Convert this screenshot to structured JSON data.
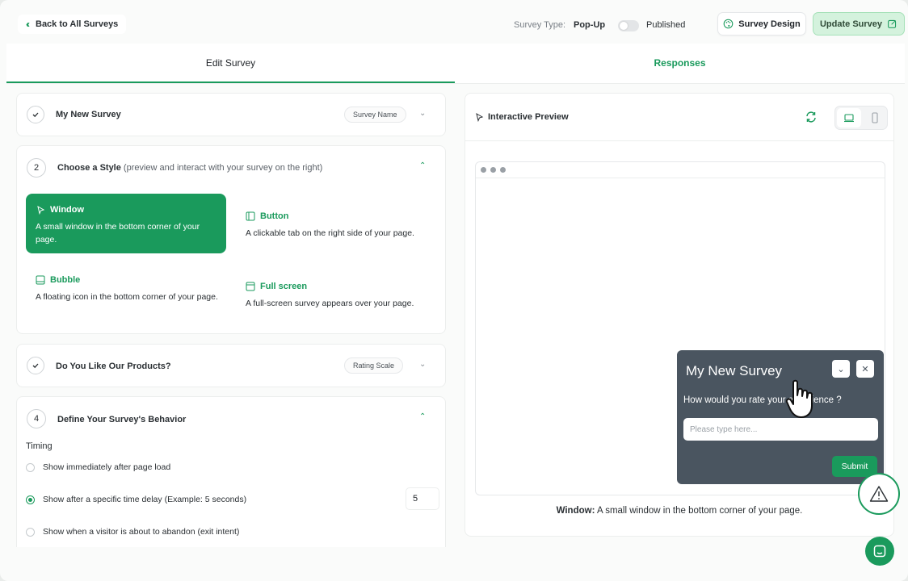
{
  "topbar": {
    "back_label": "Back to All Surveys",
    "survey_type_label": "Survey Type:",
    "survey_type_value": "Pop-Up",
    "published_label": "Published",
    "published_on": false,
    "design_label": "Survey Design",
    "update_label": "Update Survey"
  },
  "tabs": {
    "edit": "Edit Survey",
    "responses": "Responses"
  },
  "steps": {
    "name": {
      "title": "My New Survey",
      "pill": "Survey Name"
    },
    "style": {
      "number": "2",
      "title": "Choose a Style",
      "subtitle": "(preview and interact with your survey on the right)",
      "options": [
        {
          "title": "Window",
          "desc": "A small window in the bottom corner of your page.",
          "selected": true
        },
        {
          "title": "Button",
          "desc": "A clickable tab on the right side of your page.",
          "selected": false
        },
        {
          "title": "Bubble",
          "desc": "A floating icon in the bottom corner of your page.",
          "selected": false
        },
        {
          "title": "Full screen",
          "desc": "A full-screen survey appears over your page.",
          "selected": false
        }
      ]
    },
    "question": {
      "title": "Do You Like Our Products?",
      "pill": "Rating Scale"
    },
    "behavior": {
      "number": "4",
      "title": "Define Your Survey's Behavior",
      "timing_label": "Timing",
      "options": [
        "Show immediately after page load",
        "Show after a specific time delay (Example: 5 seconds)",
        "Show when a visitor is about to abandon (exit intent)"
      ],
      "selected_index": 1,
      "delay_value": "5"
    }
  },
  "preview": {
    "title": "Interactive Preview",
    "caption_bold": "Window:",
    "caption_text": " A small window in the bottom corner of your page."
  },
  "widget": {
    "title": "My New Survey",
    "question": "How would you rate your experience ?",
    "placeholder": "Please type here...",
    "submit": "Submit"
  },
  "colors": {
    "accent": "#1a9a5c",
    "widget_bg": "#4a5560"
  }
}
